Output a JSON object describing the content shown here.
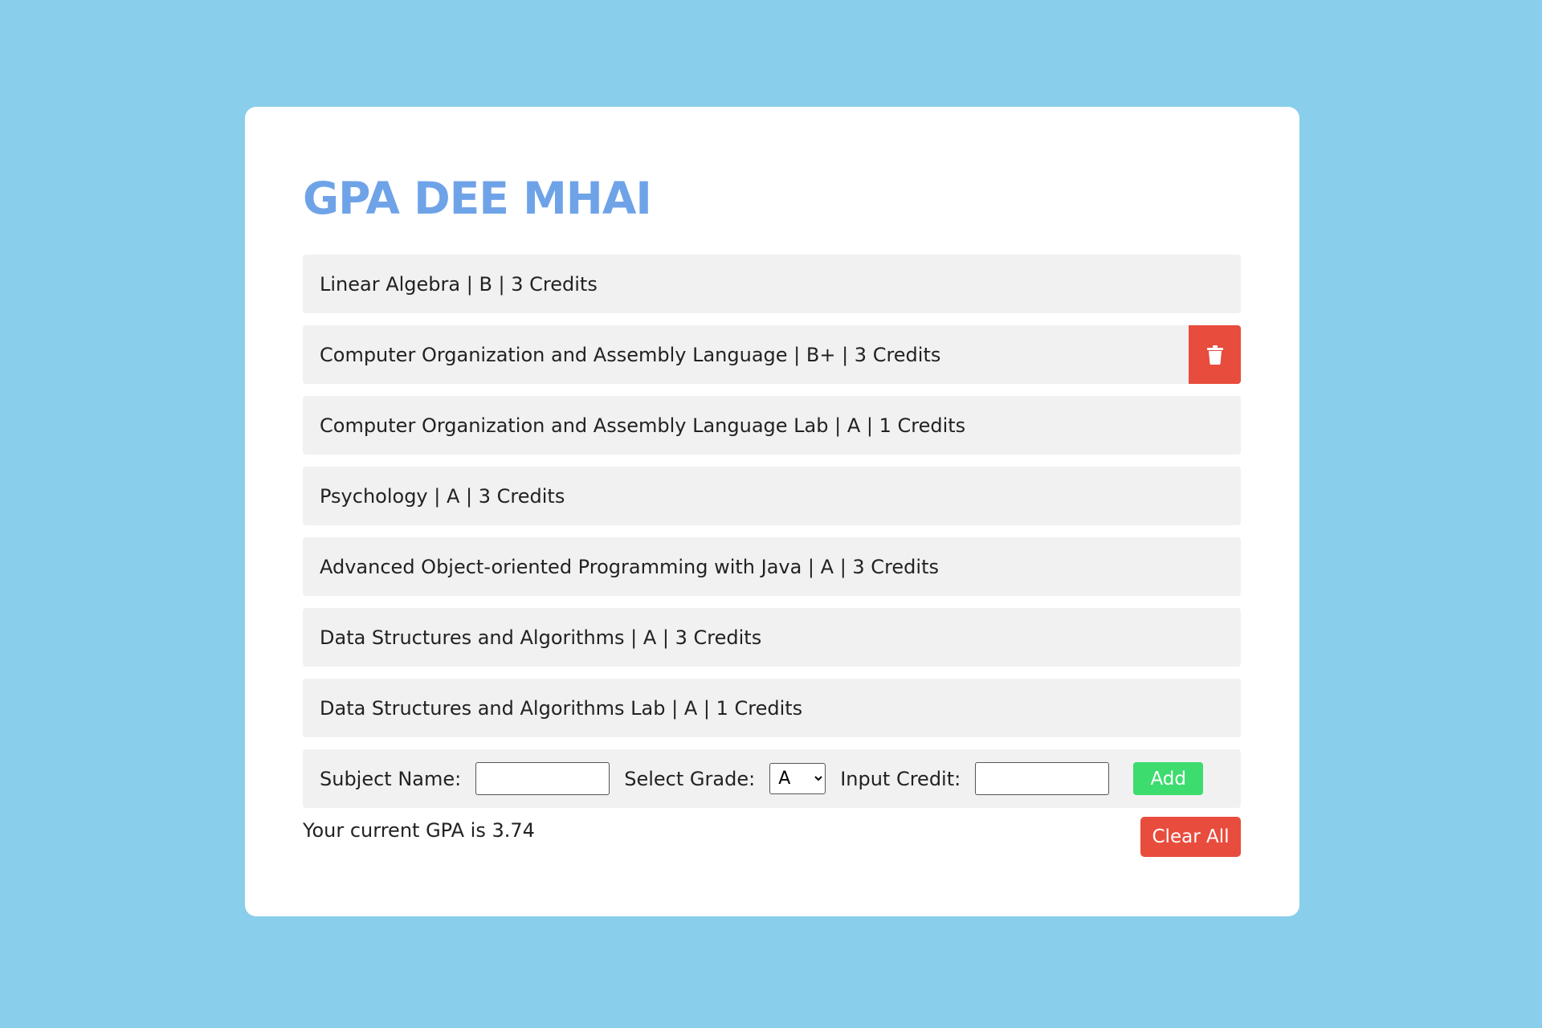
{
  "app": {
    "title": "GPA DEE MHAI"
  },
  "subjects": [
    {
      "text": "Linear Algebra | B | 3 Credits"
    },
    {
      "text": "Computer Organization and Assembly Language | B+ | 3 Credits"
    },
    {
      "text": "Computer Organization and Assembly Language Lab | A | 1 Credits"
    },
    {
      "text": "Psychology | A | 3 Credits"
    },
    {
      "text": "Advanced Object-oriented Programming with Java | A | 3 Credits"
    },
    {
      "text": "Data Structures and Algorithms | A | 3 Credits"
    },
    {
      "text": "Data Structures and Algorithms Lab | A | 1 Credits"
    }
  ],
  "delete_button": {
    "icon": "trash-icon",
    "row_index": 1
  },
  "form": {
    "subject_label": "Subject Name:",
    "subject_value": "",
    "grade_label": "Select Grade:",
    "grade_selected": "A",
    "credit_label": "Input Credit:",
    "credit_value": "",
    "add_label": "Add"
  },
  "summary": {
    "gpa_text": "Your current GPA is 3.74"
  },
  "clear_all_label": "Clear All",
  "colors": {
    "background": "#89ceea",
    "title": "#6fa3e8",
    "danger": "#e84c3d",
    "success": "#3ddc6f",
    "row": "#f1f1f1"
  }
}
